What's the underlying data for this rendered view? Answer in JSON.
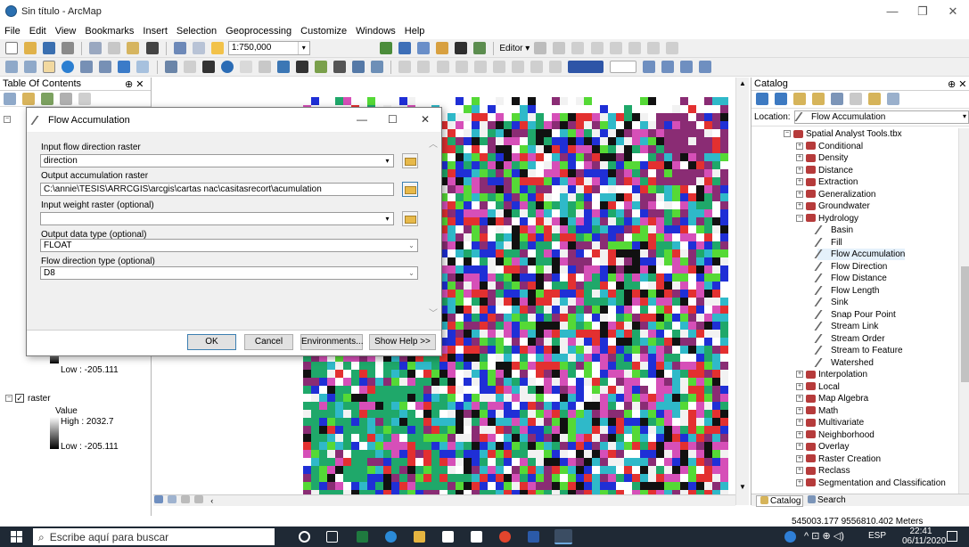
{
  "window": {
    "title": "Sin título - ArcMap",
    "min": "—",
    "max": "❐",
    "close": "✕"
  },
  "menu": [
    "File",
    "Edit",
    "View",
    "Bookmarks",
    "Insert",
    "Selection",
    "Geoprocessing",
    "Customize",
    "Windows",
    "Help"
  ],
  "toolbar": {
    "scale": "1:750,000",
    "editor_label": "Editor ▾"
  },
  "toc": {
    "title": "Table Of Contents",
    "pin": "⊕ ✕",
    "layer_low1": "Low : -205.111",
    "layer_name": "raster",
    "value_label": "Value",
    "high": "High : 2032.7",
    "low2": "Low : -205.111"
  },
  "dialog": {
    "title": "Flow Accumulation",
    "min": "—",
    "max": "☐",
    "close": "✕",
    "input_label": "Input flow direction raster",
    "input_value": "direction",
    "output_label": "Output accumulation raster",
    "output_value": "C:\\annie\\TESIS\\ARRCGIS\\arcgis\\cartas nac\\casitasrecort\\acumulation",
    "weight_label": "Input weight raster (optional)",
    "weight_value": "",
    "dtype_label": "Output data type (optional)",
    "dtype_value": "FLOAT",
    "fdir_label": "Flow direction type (optional)",
    "fdir_value": "D8",
    "ok": "OK",
    "cancel": "Cancel",
    "env": "Environments...",
    "help": "Show Help >>"
  },
  "catalog": {
    "title": "Catalog",
    "pin": "⊕ ✕",
    "location_label": "Location:",
    "location_value": "Flow Accumulation",
    "tree": [
      {
        "label": "Spatial Analyst Tools.tbx",
        "kind": "tbx",
        "indent": 0,
        "pm": "−"
      },
      {
        "label": "Conditional",
        "kind": "set",
        "indent": 1,
        "pm": "+"
      },
      {
        "label": "Density",
        "kind": "set",
        "indent": 1,
        "pm": "+"
      },
      {
        "label": "Distance",
        "kind": "set",
        "indent": 1,
        "pm": "+"
      },
      {
        "label": "Extraction",
        "kind": "set",
        "indent": 1,
        "pm": "+"
      },
      {
        "label": "Generalization",
        "kind": "set",
        "indent": 1,
        "pm": "+"
      },
      {
        "label": "Groundwater",
        "kind": "set",
        "indent": 1,
        "pm": "+"
      },
      {
        "label": "Hydrology",
        "kind": "set",
        "indent": 1,
        "pm": "−"
      },
      {
        "label": "Basin",
        "kind": "tool",
        "indent": 2
      },
      {
        "label": "Fill",
        "kind": "tool",
        "indent": 2
      },
      {
        "label": "Flow Accumulation",
        "kind": "tool",
        "indent": 2
      },
      {
        "label": "Flow Direction",
        "kind": "tool",
        "indent": 2
      },
      {
        "label": "Flow Distance",
        "kind": "tool",
        "indent": 2
      },
      {
        "label": "Flow Length",
        "kind": "tool",
        "indent": 2
      },
      {
        "label": "Sink",
        "kind": "tool",
        "indent": 2
      },
      {
        "label": "Snap Pour Point",
        "kind": "tool",
        "indent": 2
      },
      {
        "label": "Stream Link",
        "kind": "tool",
        "indent": 2
      },
      {
        "label": "Stream Order",
        "kind": "tool",
        "indent": 2
      },
      {
        "label": "Stream to Feature",
        "kind": "tool",
        "indent": 2
      },
      {
        "label": "Watershed",
        "kind": "tool",
        "indent": 2
      },
      {
        "label": "Interpolation",
        "kind": "set",
        "indent": 1,
        "pm": "+"
      },
      {
        "label": "Local",
        "kind": "set",
        "indent": 1,
        "pm": "+"
      },
      {
        "label": "Map Algebra",
        "kind": "set",
        "indent": 1,
        "pm": "+"
      },
      {
        "label": "Math",
        "kind": "set",
        "indent": 1,
        "pm": "+"
      },
      {
        "label": "Multivariate",
        "kind": "set",
        "indent": 1,
        "pm": "+"
      },
      {
        "label": "Neighborhood",
        "kind": "set",
        "indent": 1,
        "pm": "+"
      },
      {
        "label": "Overlay",
        "kind": "set",
        "indent": 1,
        "pm": "+"
      },
      {
        "label": "Raster Creation",
        "kind": "set",
        "indent": 1,
        "pm": "+"
      },
      {
        "label": "Reclass",
        "kind": "set",
        "indent": 1,
        "pm": "+"
      },
      {
        "label": "Segmentation and Classification",
        "kind": "set",
        "indent": 1,
        "pm": "+"
      }
    ],
    "tabs": [
      "Catalog",
      "Search"
    ]
  },
  "status": {
    "coords": "545003.177  9556810.402 Meters"
  },
  "taskbar": {
    "search_placeholder": "Escribe aquí para buscar",
    "lang": "ESP",
    "time": "22:41",
    "date": "06/11/2020"
  }
}
